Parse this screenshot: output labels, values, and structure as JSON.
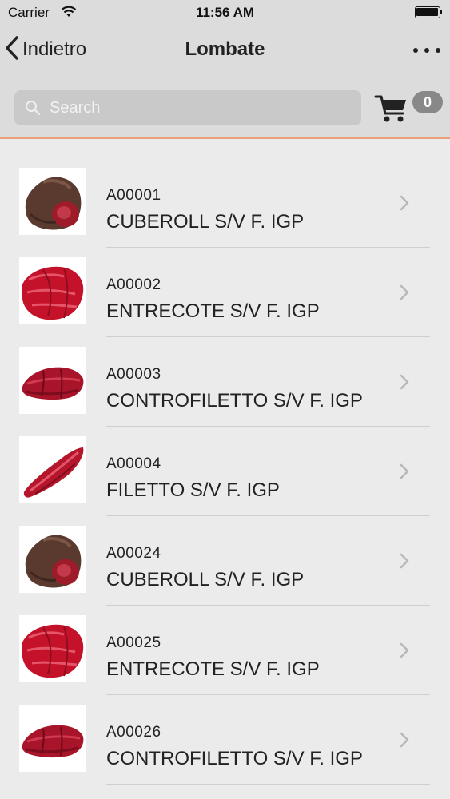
{
  "status_bar": {
    "carrier": "Carrier",
    "time": "11:56 AM"
  },
  "nav": {
    "back_label": "Indietro",
    "title": "Lombate"
  },
  "search": {
    "placeholder": "Search",
    "value": ""
  },
  "cart": {
    "count": "0"
  },
  "products": [
    {
      "code": "A00001",
      "name": "CUBEROLL S/V F. IGP",
      "image": "cuberoll-meat"
    },
    {
      "code": "A00002",
      "name": "ENTRECOTE S/V F. IGP",
      "image": "entrecote-meat"
    },
    {
      "code": "A00003",
      "name": "CONTROFILETTO S/V F. IGP",
      "image": "controfiletto-meat"
    },
    {
      "code": "A00004",
      "name": "FILETTO S/V F. IGP",
      "image": "filetto-meat"
    },
    {
      "code": "A00024",
      "name": "CUBEROLL S/V F. IGP",
      "image": "cuberoll-meat"
    },
    {
      "code": "A00025",
      "name": "ENTRECOTE S/V F. IGP",
      "image": "entrecote-meat"
    },
    {
      "code": "A00026",
      "name": "CONTROFILETTO S/V F. IGP",
      "image": "controfiletto-meat"
    }
  ],
  "colors": {
    "accent_line": "#e9a07a",
    "bar_bg": "#dcdcdc",
    "list_bg": "#ebebeb"
  }
}
